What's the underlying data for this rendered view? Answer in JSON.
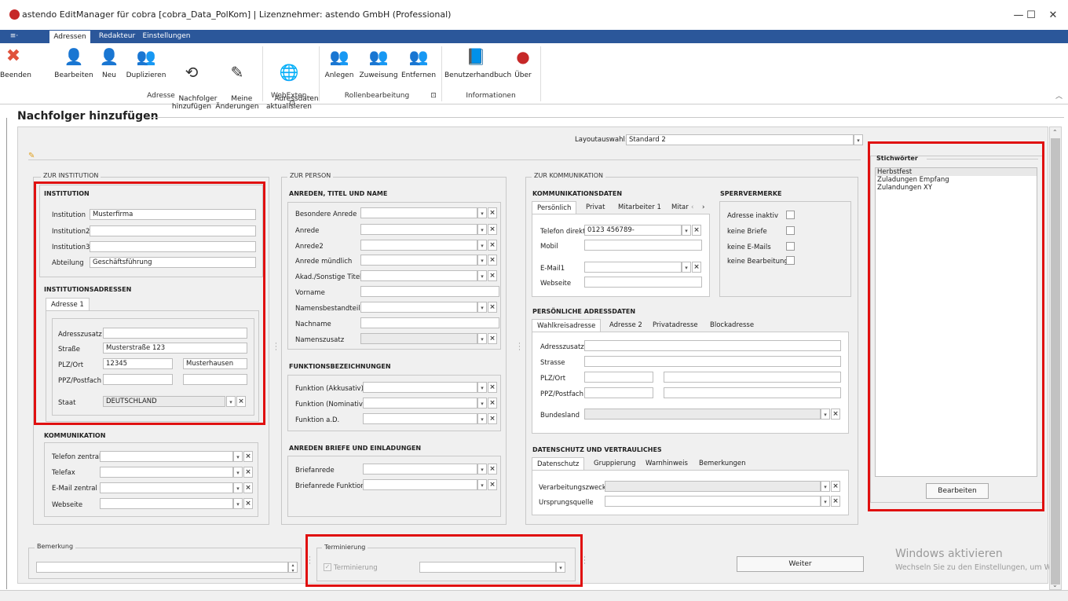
{
  "window": {
    "title": "astendo EditManager für cobra [cobra_Data_PolKom] | Lizenznehmer: astendo GmbH (Professional)",
    "minimize": "—",
    "maximize": "☐",
    "close": "✕"
  },
  "menu": {
    "app_button": "≡·",
    "tabs": [
      "Adressen",
      "Redakteur",
      "Einstellungen"
    ]
  },
  "ribbon": {
    "buttons": [
      {
        "label": "Beenden",
        "icon": "close-circle-icon"
      },
      {
        "label": "Bearbeiten",
        "icon": "user-edit-icon"
      },
      {
        "label": "Neu",
        "icon": "user-new-icon"
      },
      {
        "label": "Duplizieren",
        "icon": "user-duplicate-icon"
      },
      {
        "label": "Nachfolger\nhinzufügen",
        "icon": "successor-icon"
      },
      {
        "label": "Meine\nÄnderungen",
        "icon": "edit-notes-icon"
      },
      {
        "label": "Adressdaten\naktualisieren",
        "icon": "globe-user-icon"
      },
      {
        "label": "Anlegen",
        "icon": "role-add-icon"
      },
      {
        "label": "Zuweisung",
        "icon": "role-assign-icon"
      },
      {
        "label": "Entfernen",
        "icon": "role-remove-icon"
      },
      {
        "label": "Benutzerhandbuch",
        "icon": "manual-icon"
      },
      {
        "label": "Über",
        "icon": "about-icon"
      }
    ],
    "groups": [
      "Adresse",
      "WebExten... ⊡",
      "Rollenbearbeitung",
      "⊡",
      "Informationen"
    ]
  },
  "page_title": "Nachfolger hinzufügen",
  "layout": {
    "label": "Layoutauswahl:",
    "value": "Standard 2"
  },
  "institution": {
    "group_label": "ZUR INSTITUTION",
    "section": "INSTITUTION",
    "fields": [
      {
        "label": "Institution",
        "value": "Musterfirma"
      },
      {
        "label": "Institution2",
        "value": ""
      },
      {
        "label": "Institution3",
        "value": ""
      },
      {
        "label": "Abteilung",
        "value": "Geschäftsführung"
      }
    ],
    "addr_section": "INSTITUTIONSADRESSEN",
    "addr_tab": "Adresse 1",
    "addr_fields": {
      "adresszusatz_label": "Adresszusatz",
      "adresszusatz": "",
      "strasse_label": "Straße",
      "strasse": "Musterstraße 123",
      "plzort_label": "PLZ/Ort",
      "plz": "12345",
      "ort": "Musterhausen",
      "ppz_label": "PPZ/Postfach",
      "staat_label": "Staat",
      "staat": "DEUTSCHLAND"
    },
    "komm_section": "KOMMUNIKATION",
    "komm_fields": [
      "Telefon zentral",
      "Telefax",
      "E-Mail zentral",
      "Webseite"
    ]
  },
  "person": {
    "group_label": "ZUR PERSON",
    "section": "ANREDEN, TITEL UND NAME",
    "fields": [
      {
        "label": "Besondere Anrede",
        "kind": "combo"
      },
      {
        "label": "Anrede",
        "kind": "combo"
      },
      {
        "label": "Anrede2",
        "kind": "combo"
      },
      {
        "label": "Anrede mündlich",
        "kind": "combo"
      },
      {
        "label": "Akad./Sonstige Titel",
        "kind": "combo"
      },
      {
        "label": "Vorname",
        "kind": "text"
      },
      {
        "label": "Namensbestandteil",
        "kind": "combo"
      },
      {
        "label": "Nachname",
        "kind": "text"
      },
      {
        "label": "Namenszusatz",
        "kind": "combo-dis"
      }
    ],
    "func_section": "FUNKTIONSBEZEICHNUNGEN",
    "func_fields": [
      "Funktion (Akkusativ)",
      "Funktion (Nominativ)",
      "Funktion a.D."
    ],
    "brief_section": "ANREDEN BRIEFE UND EINLADUNGEN",
    "brief_fields": [
      "Briefanrede",
      "Briefanrede Funktion"
    ]
  },
  "kommunikation": {
    "group_label": "ZUR KOMMUNIKATION",
    "section": "KOMMUNIKATIONSDATEN",
    "tabs": [
      "Persönlich",
      "Privat",
      "Mitarbeiter 1",
      "Mitar",
      "‹",
      "›"
    ],
    "telefon_label": "Telefon direkt",
    "telefon": "0123 456789-",
    "mobil_label": "Mobil",
    "email_label": "E-Mail1",
    "webseite_label": "Webseite",
    "sperr_section": "SPERRVERMERKE",
    "sperr": [
      "Adresse inaktiv",
      "keine Briefe",
      "keine E-Mails",
      "keine Bearbeitung"
    ],
    "padr_section": "PERSÖNLICHE ADRESSDATEN",
    "padr_tabs": [
      "Wahlkreisadresse",
      "Adresse 2",
      "Privatadresse",
      "Blockadresse"
    ],
    "padr_fields": [
      "Adresszusatz",
      "Strasse",
      "PLZ/Ort",
      "PPZ/Postfach",
      "Bundesland"
    ],
    "ds_section": "DATENSCHUTZ UND VERTRAULICHES",
    "ds_tabs": [
      "Datenschutz",
      "Gruppierung",
      "Warnhinweis",
      "Bemerkungen"
    ],
    "ds_fields": [
      "Verarbeitungszweck",
      "Ursprungsquelle"
    ]
  },
  "stichwoerter": {
    "label": "Stichwörter",
    "items": [
      "Herbstfest",
      "Zuladungen Empfang",
      "Zulandungen XY"
    ],
    "button": "Bearbeiten"
  },
  "bemerkung": {
    "label": "Bemerkung"
  },
  "terminierung": {
    "label": "Terminierung",
    "check_label": "Terminierung"
  },
  "weiter": "Weiter",
  "watermark": {
    "line1": "Windows aktivieren",
    "line2": "Wechseln Sie zu den Einstellungen, um W"
  },
  "colors": {
    "accent": "#2b579a",
    "highlight": "#e01010"
  }
}
